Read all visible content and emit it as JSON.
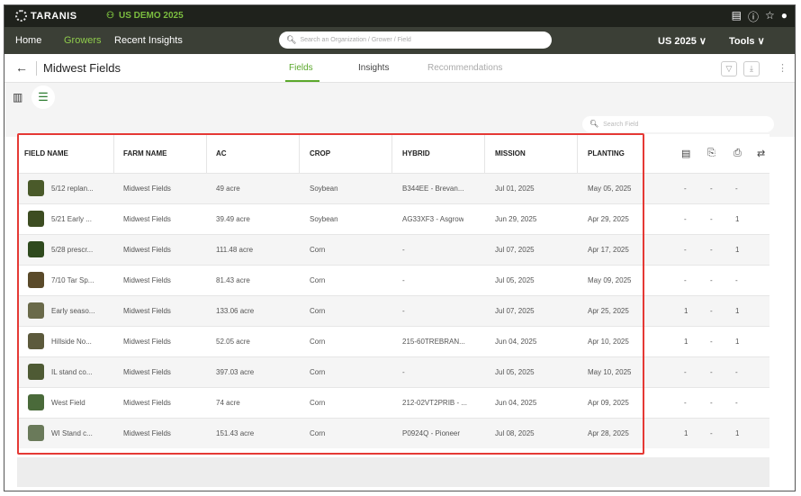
{
  "app": {
    "brand": "TARANIS",
    "org_name": "US DEMO 2025"
  },
  "nav": {
    "items": [
      "Home",
      "Growers",
      "Recent Insights"
    ],
    "search_placeholder": "Search an Organization / Grower / Field",
    "season": "US 2025",
    "tools": "Tools"
  },
  "page": {
    "title": "Midwest Fields",
    "tabs": [
      "Fields",
      "Insights",
      "Recommendations"
    ],
    "field_search_placeholder": "Search Field"
  },
  "table": {
    "columns": [
      "FIELD NAME",
      "FARM NAME",
      "AC",
      "CROP",
      "HYBRID",
      "MISSION",
      "PLANTING"
    ],
    "header_icons": [
      "comment-icon",
      "clipboard-icon",
      "trash-doc-icon",
      "sort-icon"
    ],
    "rows": [
      {
        "field": "5/12 replan...",
        "farm": "Midwest Fields",
        "ac": "49 acre",
        "crop": "Soybean",
        "hybrid": "B344EE - Brevan...",
        "mission": "Jul 01, 2025",
        "planting": "May 05, 2025",
        "c1": "-",
        "c2": "-",
        "c3": "-",
        "thumb": "#4a5a2a"
      },
      {
        "field": "5/21 Early ...",
        "farm": "Midwest Fields",
        "ac": "39.49 acre",
        "crop": "Soybean",
        "hybrid": "AG33XF3 - Asgrow",
        "mission": "Jun 29, 2025",
        "planting": "Apr 29, 2025",
        "c1": "-",
        "c2": "-",
        "c3": "1",
        "thumb": "#3d4d22"
      },
      {
        "field": "5/28 prescr...",
        "farm": "Midwest Fields",
        "ac": "111.48 acre",
        "crop": "Corn",
        "hybrid": "-",
        "mission": "Jul 07, 2025",
        "planting": "Apr 17, 2025",
        "c1": "-",
        "c2": "-",
        "c3": "1",
        "thumb": "#2f4a1e"
      },
      {
        "field": "7/10 Tar Sp...",
        "farm": "Midwest Fields",
        "ac": "81.43 acre",
        "crop": "Corn",
        "hybrid": "-",
        "mission": "Jul 05, 2025",
        "planting": "May 09, 2025",
        "c1": "-",
        "c2": "-",
        "c3": "-",
        "thumb": "#5a4a2a"
      },
      {
        "field": "Early seaso...",
        "farm": "Midwest Fields",
        "ac": "133.06 acre",
        "crop": "Corn",
        "hybrid": "-",
        "mission": "Jul 07, 2025",
        "planting": "Apr 25, 2025",
        "c1": "1",
        "c2": "-",
        "c3": "1",
        "thumb": "#6a6a4a"
      },
      {
        "field": "Hillside No...",
        "farm": "Midwest Fields",
        "ac": "52.05 acre",
        "crop": "Corn",
        "hybrid": "215-60TREBRAN...",
        "mission": "Jun 04, 2025",
        "planting": "Apr 10, 2025",
        "c1": "1",
        "c2": "-",
        "c3": "1",
        "thumb": "#5c5a3c"
      },
      {
        "field": "IL stand co...",
        "farm": "Midwest Fields",
        "ac": "397.03 acre",
        "crop": "Corn",
        "hybrid": "-",
        "mission": "Jul 05, 2025",
        "planting": "May 10, 2025",
        "c1": "-",
        "c2": "-",
        "c3": "-",
        "thumb": "#4e5a34"
      },
      {
        "field": "West Field",
        "farm": "Midwest Fields",
        "ac": "74 acre",
        "crop": "Corn",
        "hybrid": "212-02VT2PRIB - ...",
        "mission": "Jun 04, 2025",
        "planting": "Apr 09, 2025",
        "c1": "-",
        "c2": "-",
        "c3": "-",
        "thumb": "#4a6a3a"
      },
      {
        "field": "WI Stand c...",
        "farm": "Midwest Fields",
        "ac": "151.43 acre",
        "crop": "Corn",
        "hybrid": "P0924Q - Pioneer",
        "mission": "Jul 08, 2025",
        "planting": "Apr 28, 2025",
        "c1": "1",
        "c2": "-",
        "c3": "1",
        "thumb": "#6a7a5a"
      }
    ]
  },
  "colors": {
    "accent": "#5ba82c",
    "topbar": "#1f221c",
    "navbar": "#3b3f36",
    "highlight": "#e53935"
  }
}
